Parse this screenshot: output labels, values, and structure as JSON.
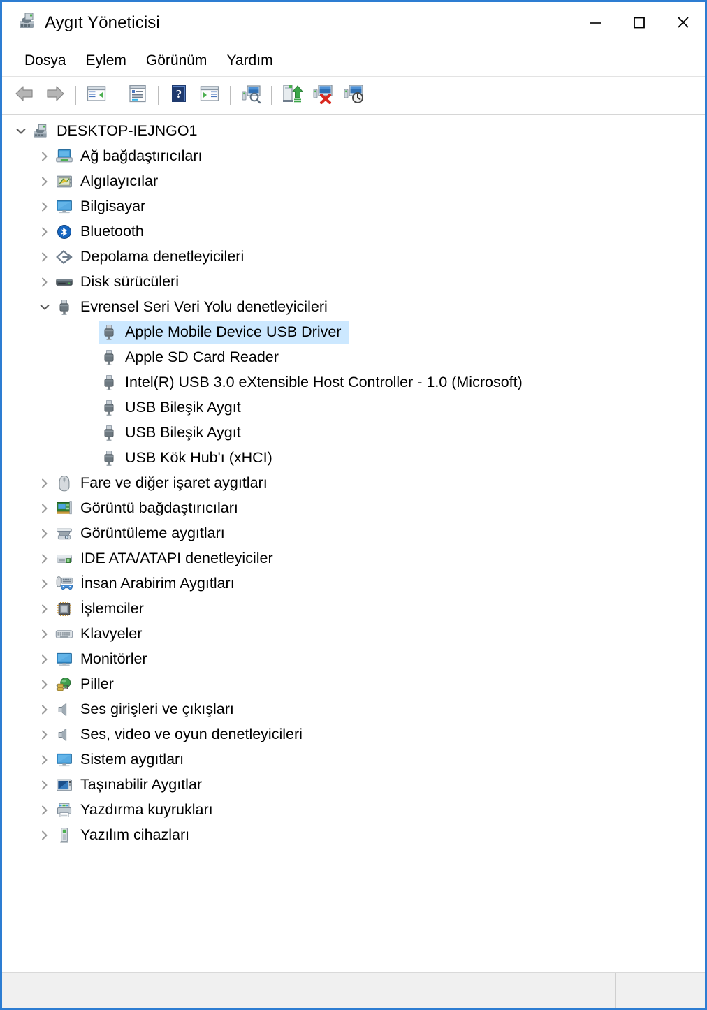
{
  "window": {
    "title": "Aygıt Yöneticisi",
    "title_icon": "device-manager-icon",
    "controls": {
      "minimize": "minimize-icon",
      "maximize": "maximize-icon",
      "close": "close-icon"
    },
    "border_color": "#2d7dd2"
  },
  "menu": {
    "items": [
      {
        "label": "Dosya"
      },
      {
        "label": "Eylem"
      },
      {
        "label": "Görünüm"
      },
      {
        "label": "Yardım"
      }
    ]
  },
  "toolbar": {
    "buttons": [
      {
        "name": "back-button",
        "icon": "back-arrow-icon"
      },
      {
        "name": "forward-button",
        "icon": "forward-arrow-icon"
      },
      {
        "name": "show-hide-console-tree-button",
        "icon": "console-tree-icon"
      },
      {
        "name": "properties-button",
        "icon": "properties-icon"
      },
      {
        "name": "help-button",
        "icon": "help-question-icon"
      },
      {
        "name": "show-hide-action-pane-button",
        "icon": "action-pane-icon"
      },
      {
        "name": "scan-hardware-changes-button",
        "icon": "scan-hardware-icon"
      },
      {
        "name": "update-driver-button",
        "icon": "update-driver-icon"
      },
      {
        "name": "uninstall-device-button",
        "icon": "uninstall-device-icon"
      },
      {
        "name": "disable-device-button",
        "icon": "disable-device-icon"
      }
    ]
  },
  "tree": {
    "selected_index": 8,
    "selection_color": "#cce8ff",
    "items": [
      {
        "label": "DESKTOP-IEJNGO1",
        "depth": 0,
        "icon": "computer-root-icon",
        "expander": "expanded",
        "selected": false
      },
      {
        "label": "Ağ bağdaştırıcıları",
        "depth": 1,
        "icon": "network-adapter-icon",
        "expander": "collapsed",
        "selected": false
      },
      {
        "label": "Algılayıcılar",
        "depth": 1,
        "icon": "sensors-icon",
        "expander": "collapsed",
        "selected": false
      },
      {
        "label": "Bilgisayar",
        "depth": 1,
        "icon": "computer-icon",
        "expander": "collapsed",
        "selected": false
      },
      {
        "label": "Bluetooth",
        "depth": 1,
        "icon": "bluetooth-icon",
        "expander": "collapsed",
        "selected": false
      },
      {
        "label": "Depolama denetleyicileri",
        "depth": 1,
        "icon": "storage-controller-icon",
        "expander": "collapsed",
        "selected": false
      },
      {
        "label": "Disk sürücüleri",
        "depth": 1,
        "icon": "disk-drive-icon",
        "expander": "collapsed",
        "selected": false
      },
      {
        "label": "Evrensel Seri Veri Yolu denetleyicileri",
        "depth": 1,
        "icon": "usb-icon",
        "expander": "expanded",
        "selected": false
      },
      {
        "label": "Apple Mobile Device USB Driver",
        "depth": 2,
        "icon": "usb-device-icon",
        "expander": "none",
        "selected": true
      },
      {
        "label": "Apple SD Card Reader",
        "depth": 2,
        "icon": "usb-device-icon",
        "expander": "none",
        "selected": false
      },
      {
        "label": "Intel(R) USB 3.0 eXtensible Host Controller - 1.0 (Microsoft)",
        "depth": 2,
        "icon": "usb-device-icon",
        "expander": "none",
        "selected": false
      },
      {
        "label": "USB Bileşik Aygıt",
        "depth": 2,
        "icon": "usb-device-icon",
        "expander": "none",
        "selected": false
      },
      {
        "label": "USB Bileşik Aygıt",
        "depth": 2,
        "icon": "usb-device-icon",
        "expander": "none",
        "selected": false
      },
      {
        "label": "USB Kök Hub'ı (xHCI)",
        "depth": 2,
        "icon": "usb-device-icon",
        "expander": "none",
        "selected": false
      },
      {
        "label": "Fare ve diğer işaret aygıtları",
        "depth": 1,
        "icon": "mouse-icon",
        "expander": "collapsed",
        "selected": false
      },
      {
        "label": "Görüntü bağdaştırıcıları",
        "depth": 1,
        "icon": "display-adapter-icon",
        "expander": "collapsed",
        "selected": false
      },
      {
        "label": "Görüntüleme aygıtları",
        "depth": 1,
        "icon": "imaging-device-icon",
        "expander": "collapsed",
        "selected": false
      },
      {
        "label": "IDE ATA/ATAPI denetleyiciler",
        "depth": 1,
        "icon": "ide-controller-icon",
        "expander": "collapsed",
        "selected": false
      },
      {
        "label": "İnsan Arabirim Aygıtları",
        "depth": 1,
        "icon": "hid-icon",
        "expander": "collapsed",
        "selected": false
      },
      {
        "label": "İşlemciler",
        "depth": 1,
        "icon": "processor-icon",
        "expander": "collapsed",
        "selected": false
      },
      {
        "label": "Klavyeler",
        "depth": 1,
        "icon": "keyboard-icon",
        "expander": "collapsed",
        "selected": false
      },
      {
        "label": "Monitörler",
        "depth": 1,
        "icon": "monitor-icon",
        "expander": "collapsed",
        "selected": false
      },
      {
        "label": "Piller",
        "depth": 1,
        "icon": "battery-icon",
        "expander": "collapsed",
        "selected": false
      },
      {
        "label": "Ses girişleri ve çıkışları",
        "depth": 1,
        "icon": "audio-io-icon",
        "expander": "collapsed",
        "selected": false
      },
      {
        "label": "Ses, video ve oyun denetleyicileri",
        "depth": 1,
        "icon": "sound-video-game-icon",
        "expander": "collapsed",
        "selected": false
      },
      {
        "label": "Sistem aygıtları",
        "depth": 1,
        "icon": "system-device-icon",
        "expander": "collapsed",
        "selected": false
      },
      {
        "label": "Taşınabilir Aygıtlar",
        "depth": 1,
        "icon": "portable-device-icon",
        "expander": "collapsed",
        "selected": false
      },
      {
        "label": "Yazdırma kuyrukları",
        "depth": 1,
        "icon": "print-queue-icon",
        "expander": "collapsed",
        "selected": false
      },
      {
        "label": "Yazılım cihazları",
        "depth": 1,
        "icon": "software-device-icon",
        "expander": "collapsed",
        "selected": false
      }
    ]
  },
  "statusbar": {
    "panes": [
      "",
      "",
      ""
    ]
  }
}
